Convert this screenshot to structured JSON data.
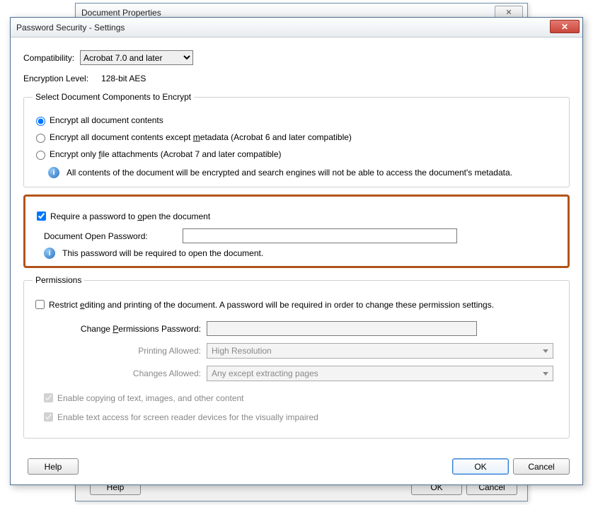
{
  "back_dialog": {
    "title": "Document Properties",
    "help": "Help",
    "ok": "OK",
    "cancel": "Cancel",
    "close_glyph": "✕"
  },
  "front_dialog": {
    "title": "Password Security - Settings",
    "close_glyph": "✕"
  },
  "compatibility": {
    "label": "Compatibility:",
    "value": "Acrobat 7.0 and later"
  },
  "encryption": {
    "label": "Encryption  Level:",
    "value": "128-bit AES"
  },
  "encrypt_group": {
    "legend": "Select Document Components to Encrypt",
    "opt1": "Encrypt all document contents",
    "opt2_pre": "Encrypt all document contents except ",
    "opt2_u": "m",
    "opt2_post": "etadata (Acrobat 6 and later compatible)",
    "opt3_pre": "Encrypt only ",
    "opt3_u": "f",
    "opt3_post": "ile attachments (Acrobat 7 and later compatible)",
    "info": "All contents of the document will be encrypted and search engines will not be able to access the document's metadata."
  },
  "open_pw": {
    "checkbox_pre": "Require a password to ",
    "checkbox_u": "o",
    "checkbox_post": "pen the document",
    "label": "Document Open Password:",
    "info": "This password will be required to open the document."
  },
  "permissions": {
    "legend": "Permissions",
    "restrict_pre": "Restrict ",
    "restrict_u": "e",
    "restrict_post": "diting and printing of the document. A password will be required in order to change these permission settings.",
    "change_pw_label_pre": "Change ",
    "change_pw_label_u": "P",
    "change_pw_label_post": "ermissions Password:",
    "printing_label": "Printing Allowed:",
    "printing_value": "High Resolution",
    "changes_label": "Changes Allowed:",
    "changes_value": "Any except extracting pages",
    "enable_copy": "Enable copying of text, images, and other content",
    "enable_screenreader": "Enable text access for screen reader devices for the visually impaired"
  },
  "footer": {
    "help": "Help",
    "ok": "OK",
    "cancel": "Cancel"
  }
}
